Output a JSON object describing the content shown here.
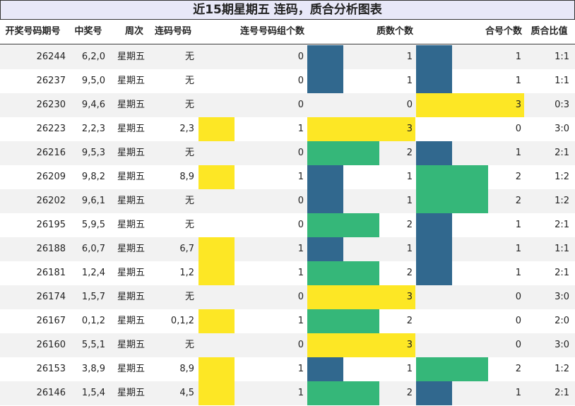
{
  "title": "近15期星期五 连码，质合分析图表",
  "colors": {
    "yellow": "#fde725",
    "green": "#35b779",
    "blue": "#31688e",
    "header_bg": "#e8e8f8",
    "stripe": "#f2f2f2"
  },
  "headers": [
    "开奖号码期号",
    "中奖号",
    "周次",
    "连码号码",
    "连号号码组个数",
    "质数个数",
    "合号个数",
    "质合比值"
  ],
  "chart_data": {
    "type": "table",
    "columns": [
      "开奖号码期号",
      "中奖号",
      "周次",
      "连码号码",
      "连号号码组个数",
      "质数个数",
      "合号个数",
      "质合比值"
    ],
    "rows": [
      [
        "26244",
        "6,2,0",
        "星期五",
        "无",
        0,
        1,
        1,
        "1:1"
      ],
      [
        "26237",
        "9,5,0",
        "星期五",
        "无",
        0,
        1,
        1,
        "1:1"
      ],
      [
        "26230",
        "9,4,6",
        "星期五",
        "无",
        0,
        0,
        3,
        "0:3"
      ],
      [
        "26223",
        "2,2,3",
        "星期五",
        "2,3",
        1,
        3,
        0,
        "3:0"
      ],
      [
        "26216",
        "9,5,3",
        "星期五",
        "无",
        0,
        2,
        1,
        "2:1"
      ],
      [
        "26209",
        "9,8,2",
        "星期五",
        "8,9",
        1,
        1,
        2,
        "1:2"
      ],
      [
        "26202",
        "9,6,1",
        "星期五",
        "无",
        0,
        1,
        2,
        "1:2"
      ],
      [
        "26195",
        "5,9,5",
        "星期五",
        "无",
        0,
        2,
        1,
        "2:1"
      ],
      [
        "26188",
        "6,0,7",
        "星期五",
        "6,7",
        1,
        1,
        1,
        "1:1"
      ],
      [
        "26181",
        "1,2,4",
        "星期五",
        "1,2",
        1,
        2,
        1,
        "2:1"
      ],
      [
        "26174",
        "1,5,7",
        "星期五",
        "无",
        0,
        3,
        0,
        "3:0"
      ],
      [
        "26167",
        "0,1,2",
        "星期五",
        "0,1,2",
        1,
        2,
        0,
        "2:0"
      ],
      [
        "26160",
        "5,5,1",
        "星期五",
        "无",
        0,
        3,
        0,
        "3:0"
      ],
      [
        "26153",
        "3,8,9",
        "星期五",
        "8,9",
        1,
        1,
        2,
        "1:2"
      ],
      [
        "26146",
        "1,5,4",
        "星期五",
        "4,5",
        1,
        2,
        1,
        "2:1"
      ]
    ]
  }
}
